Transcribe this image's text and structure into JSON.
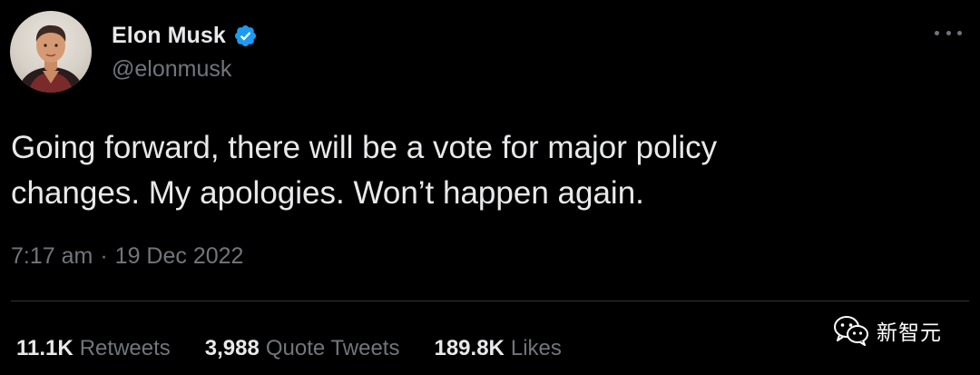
{
  "author": {
    "display_name": "Elon Musk",
    "handle": "@elonmusk",
    "verified": true
  },
  "tweet": {
    "line1": "Going forward, there will be a vote for major policy",
    "line2": "changes. My apologies. Won’t happen again.",
    "time": "7:17 am",
    "separator": "·",
    "date": "19 Dec 2022"
  },
  "stats": {
    "retweets": {
      "count": "11.1K",
      "label": "Retweets"
    },
    "quote_tweets": {
      "count": "3,988",
      "label": "Quote Tweets"
    },
    "likes": {
      "count": "189.8K",
      "label": "Likes"
    }
  },
  "watermark": {
    "text": "新智元",
    "icon": "wechat-icon"
  },
  "icons": {
    "verified": "verified-badge-icon",
    "more": "more-options-icon",
    "avatar": "avatar"
  },
  "colors": {
    "background": "#000000",
    "primary_text": "#e7e9ea",
    "secondary_text": "#71767b",
    "verified_blue": "#1d9bf0",
    "divider": "#2f3336"
  }
}
